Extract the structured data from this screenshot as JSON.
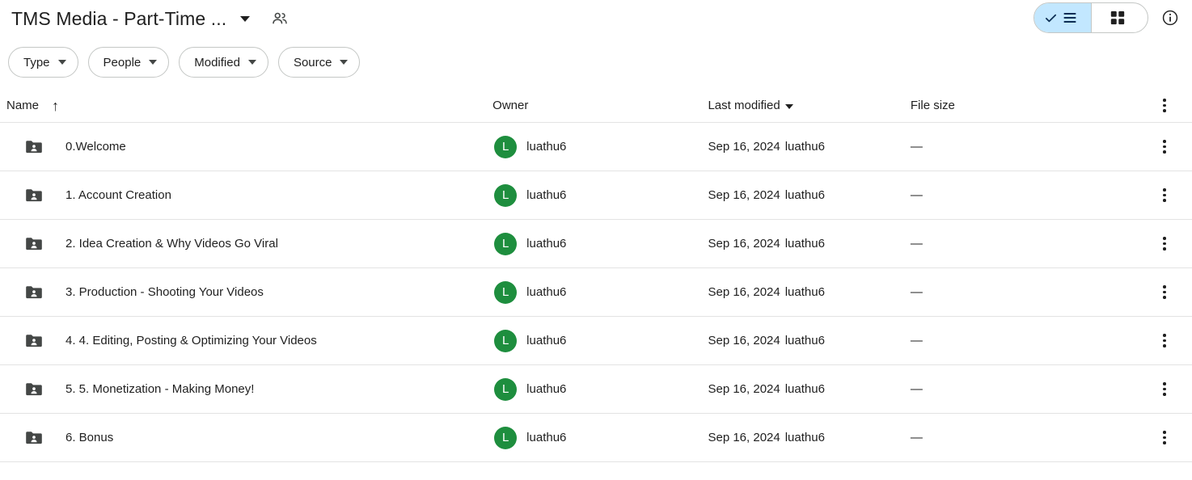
{
  "header": {
    "title": "TMS Media - Part-Time ...",
    "title_caret_icon": "chevron-down-icon",
    "people_icon": "people-shared-icon",
    "view_list_label": "",
    "view_grid_label": "",
    "list_view_icon": "list-view-check-icon",
    "grid_view_icon": "grid-view-icon",
    "info_icon": "info-circle-icon",
    "active_view": "list"
  },
  "filters": [
    {
      "label": "Type",
      "name": "filter-type"
    },
    {
      "label": "People",
      "name": "filter-people"
    },
    {
      "label": "Modified",
      "name": "filter-modified"
    },
    {
      "label": "Source",
      "name": "filter-source"
    }
  ],
  "columns": {
    "name": "Name",
    "sort_arrow": "↑",
    "owner": "Owner",
    "last_modified": "Last modified",
    "file_size": "File size"
  },
  "colors": {
    "avatar_green": "#1e8e3e",
    "active_toggle_blue": "#c2e7ff",
    "folder_gray": "#444746",
    "border_gray": "#e3e3e3"
  },
  "rows": [
    {
      "name": "0.Welcome",
      "owner": "luathu6",
      "avatar_letter": "L",
      "modified_date": "Sep 16, 2024",
      "modified_user": "luathu6",
      "size": "—"
    },
    {
      "name": "1. Account Creation",
      "owner": "luathu6",
      "avatar_letter": "L",
      "modified_date": "Sep 16, 2024",
      "modified_user": "luathu6",
      "size": "—"
    },
    {
      "name": "2. Idea Creation & Why Videos Go Viral",
      "owner": "luathu6",
      "avatar_letter": "L",
      "modified_date": "Sep 16, 2024",
      "modified_user": "luathu6",
      "size": "—"
    },
    {
      "name": "3. Production - Shooting Your Videos",
      "owner": "luathu6",
      "avatar_letter": "L",
      "modified_date": "Sep 16, 2024",
      "modified_user": "luathu6",
      "size": "—"
    },
    {
      "name": "4. 4. Editing, Posting & Optimizing Your Videos",
      "owner": "luathu6",
      "avatar_letter": "L",
      "modified_date": "Sep 16, 2024",
      "modified_user": "luathu6",
      "size": "—"
    },
    {
      "name": "5. 5. Monetization - Making Money!",
      "owner": "luathu6",
      "avatar_letter": "L",
      "modified_date": "Sep 16, 2024",
      "modified_user": "luathu6",
      "size": "—"
    },
    {
      "name": "6. Bonus",
      "owner": "luathu6",
      "avatar_letter": "L",
      "modified_date": "Sep 16, 2024",
      "modified_user": "luathu6",
      "size": "—"
    }
  ]
}
